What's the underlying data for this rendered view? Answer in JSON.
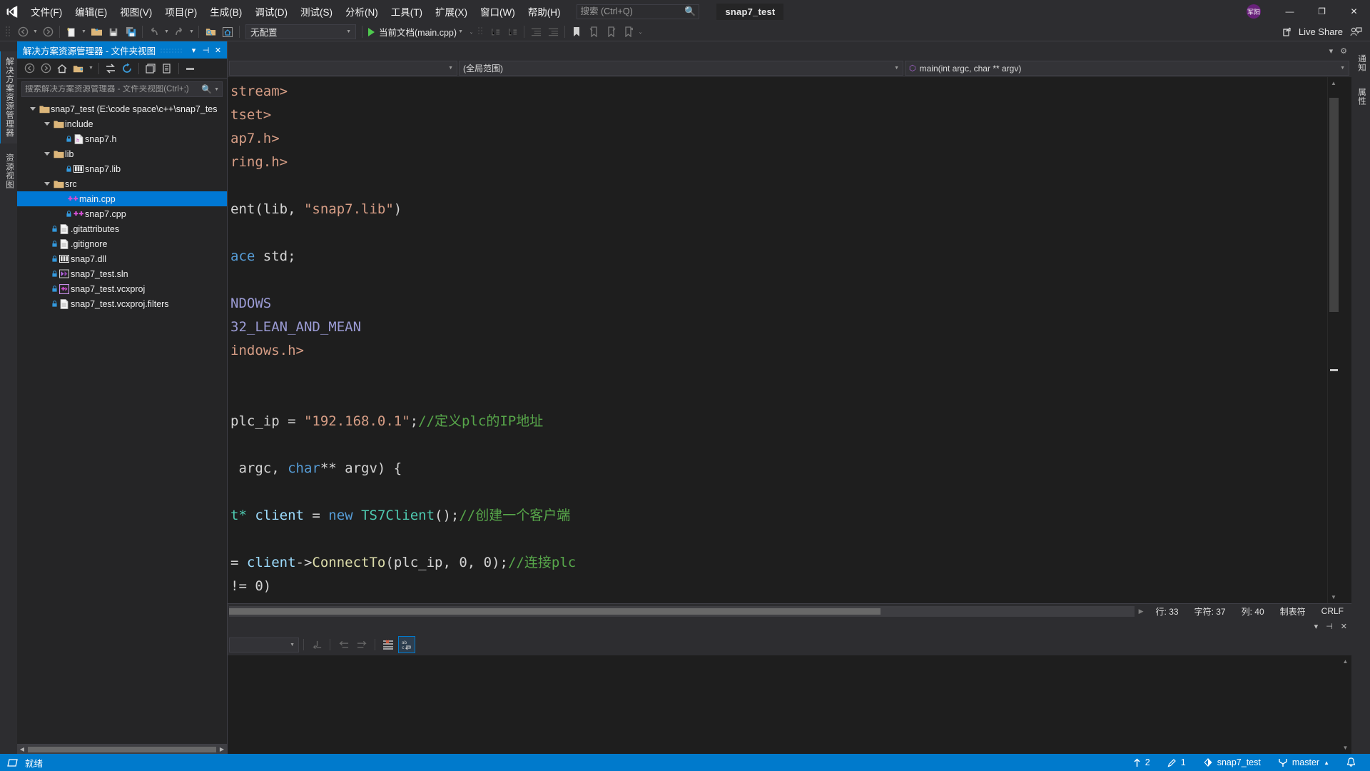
{
  "app": {
    "logo_icon": "visual-studio-logo",
    "solution_chip": "snap7_test"
  },
  "menu": {
    "items": [
      {
        "label": "文件(F)"
      },
      {
        "label": "编辑(E)"
      },
      {
        "label": "视图(V)"
      },
      {
        "label": "项目(P)"
      },
      {
        "label": "生成(B)"
      },
      {
        "label": "调试(D)"
      },
      {
        "label": "测试(S)"
      },
      {
        "label": "分析(N)"
      },
      {
        "label": "工具(T)"
      },
      {
        "label": "扩展(X)"
      },
      {
        "label": "窗口(W)"
      },
      {
        "label": "帮助(H)"
      }
    ],
    "search_placeholder": "搜索 (Ctrl+Q)",
    "search_value": "",
    "search_icon": "search-icon"
  },
  "window_controls": {
    "user_badge": "军阳",
    "minimize": "—",
    "maximize": "❐",
    "close": "✕"
  },
  "toolbar": {
    "config_value": "无配置",
    "run_target": "当前文档(main.cpp)",
    "live_share": "Live Share",
    "icons": [
      "back-arrow-icon",
      "forward-arrow-icon",
      "new-item-icon",
      "open-folder-icon",
      "save-icon",
      "save-all-icon",
      "undo-icon",
      "redo-icon",
      "find-icon",
      "home-icon",
      "bookmark-icon"
    ]
  },
  "left_tabs": [
    {
      "label": "解决方案资源管理器",
      "active": true
    },
    {
      "label": "资源视图",
      "active": false
    }
  ],
  "right_tabs": [
    {
      "label": "通知"
    },
    {
      "label": "属性"
    }
  ],
  "solution_explorer": {
    "title": "解决方案资源管理器 - 文件夹视图",
    "header_buttons": [
      "chevron-down-icon",
      "pin-icon",
      "close-icon"
    ],
    "toolbar_icons": [
      "nav-back-icon",
      "nav-forward-icon",
      "home-icon",
      "new-folder-icon",
      "sync-icon",
      "refresh-icon",
      "collapse-all-icon",
      "properties-icon",
      "show-all-icon"
    ],
    "search_placeholder": "搜索解决方案资源管理器 - 文件夹视图(Ctrl+;)",
    "search_value": "",
    "tree": [
      {
        "label": "snap7_test (E:\\code space\\c++\\snap7_tes",
        "depth": 0,
        "icon": "folder-icon",
        "expander": true,
        "selected": false,
        "lock": false
      },
      {
        "label": "include",
        "depth": 1,
        "icon": "folder-icon",
        "expander": true,
        "selected": false,
        "lock": false
      },
      {
        "label": "snap7.h",
        "depth": 2,
        "icon": "header-file-icon",
        "expander": false,
        "selected": false,
        "lock": true
      },
      {
        "label": "lib",
        "depth": 1,
        "icon": "folder-icon",
        "expander": true,
        "selected": false,
        "lock": false
      },
      {
        "label": "snap7.lib",
        "depth": 2,
        "icon": "library-file-icon",
        "expander": false,
        "selected": false,
        "lock": true
      },
      {
        "label": "src",
        "depth": 1,
        "icon": "folder-icon",
        "expander": true,
        "selected": false,
        "lock": false
      },
      {
        "label": "main.cpp",
        "depth": 2,
        "icon": "cpp-file-icon",
        "expander": false,
        "selected": true,
        "lock": false
      },
      {
        "label": "snap7.cpp",
        "depth": 2,
        "icon": "cpp-file-icon",
        "expander": false,
        "selected": false,
        "lock": true
      },
      {
        "label": ".gitattributes",
        "depth": 1,
        "icon": "text-file-icon",
        "expander": false,
        "selected": false,
        "lock": true
      },
      {
        "label": ".gitignore",
        "depth": 1,
        "icon": "text-file-icon",
        "expander": false,
        "selected": false,
        "lock": true
      },
      {
        "label": "snap7.dll",
        "depth": 1,
        "icon": "library-file-icon",
        "expander": false,
        "selected": false,
        "lock": true
      },
      {
        "label": "snap7_test.sln",
        "depth": 1,
        "icon": "solution-file-icon",
        "expander": false,
        "selected": false,
        "lock": true
      },
      {
        "label": "snap7_test.vcxproj",
        "depth": 1,
        "icon": "project-file-icon",
        "expander": false,
        "selected": false,
        "lock": true
      },
      {
        "label": "snap7_test.vcxproj.filters",
        "depth": 1,
        "icon": "text-file-icon",
        "expander": false,
        "selected": false,
        "lock": true
      }
    ]
  },
  "editor": {
    "nav_scope_value": "",
    "nav_scope_global": "(全局范围)",
    "nav_member": "main(int argc, char ** argv)",
    "nav_member_icon": "method-icon",
    "code_lines": [
      [
        {
          "t": "stream>",
          "c": "k-str"
        }
      ],
      [
        {
          "t": "tset>",
          "c": "k-str"
        }
      ],
      [
        {
          "t": "ap7.h>",
          "c": "k-str"
        }
      ],
      [
        {
          "t": "ring.h>",
          "c": "k-str"
        }
      ],
      [],
      [
        {
          "t": "ent(lib, ",
          "c": "k-txt"
        },
        {
          "t": "\"snap7.lib\"",
          "c": "k-str"
        },
        {
          "t": ")",
          "c": "k-txt"
        }
      ],
      [],
      [
        {
          "t": "ace",
          "c": "k-key"
        },
        {
          "t": " std;",
          "c": "k-txt"
        }
      ],
      [],
      [
        {
          "t": "NDOWS",
          "c": "k-pre"
        }
      ],
      [
        {
          "t": "32_LEAN_AND_MEAN",
          "c": "k-pre"
        }
      ],
      [
        {
          "t": "indows.h>",
          "c": "k-str"
        }
      ],
      [],
      [],
      [
        {
          "t": "plc_ip = ",
          "c": "k-txt"
        },
        {
          "t": "\"192.168.0.1\"",
          "c": "k-str"
        },
        {
          "t": ";",
          "c": "k-txt"
        },
        {
          "t": "//定义plc的IP地址",
          "c": "k-cmt"
        }
      ],
      [],
      [
        {
          "t": " argc, ",
          "c": "k-txt"
        },
        {
          "t": "char",
          "c": "k-key"
        },
        {
          "t": "** argv) {",
          "c": "k-txt"
        }
      ],
      [],
      [
        {
          "t": "t* ",
          "c": "k-type"
        },
        {
          "t": "client",
          "c": "k-var"
        },
        {
          "t": " = ",
          "c": "k-txt"
        },
        {
          "t": "new",
          "c": "k-key"
        },
        {
          "t": " ",
          "c": "k-txt"
        },
        {
          "t": "TS7Client",
          "c": "k-type"
        },
        {
          "t": "();",
          "c": "k-txt"
        },
        {
          "t": "//创建一个客户端",
          "c": "k-cmt"
        }
      ],
      [],
      [
        {
          "t": "= ",
          "c": "k-txt"
        },
        {
          "t": "client",
          "c": "k-var"
        },
        {
          "t": "->",
          "c": "k-txt"
        },
        {
          "t": "ConnectTo",
          "c": "k-fn"
        },
        {
          "t": "(plc_ip, 0, 0);",
          "c": "k-txt"
        },
        {
          "t": "//连接plc",
          "c": "k-cmt"
        }
      ],
      [
        {
          "t": "!= 0)",
          "c": "k-txt"
        }
      ]
    ],
    "status": {
      "line_label": "行: 33",
      "char_label": "字符: 37",
      "col_label": "列: 40",
      "tabs_label": "制表符",
      "eol_label": "CRLF"
    }
  },
  "output_panel": {
    "combo_value": "",
    "toolbar_icons": [
      "clear-icon",
      "go-to-previous-icon",
      "go-to-next-icon",
      "clear-all-icon",
      "word-wrap-icon"
    ],
    "header_icons": [
      "chevron-down-icon",
      "pin-icon",
      "close-icon"
    ],
    "content": ""
  },
  "statusbar": {
    "ready_label": "就绪",
    "ready_icon": "ready-icon",
    "outgoing_count": "2",
    "outgoing_icon": "arrow-up-icon",
    "edits_count": "1",
    "edits_icon": "pencil-icon",
    "repo_name": "snap7_test",
    "repo_icon": "source-control-icon",
    "branch_name": "master",
    "branch_icon": "branch-icon",
    "branch_caret": "▲",
    "bell_icon": "bell-icon"
  },
  "colors": {
    "accent": "#007acc",
    "selection": "#0078d4",
    "chrome": "#2d2d30",
    "panel": "#252526",
    "editor_bg": "#1e1e1e",
    "comment_green": "#57a64a",
    "string_orange": "#d69d85",
    "keyword_blue": "#569cd6",
    "preproc_purple": "#9b9bd4",
    "type_teal": "#4ec9b0",
    "func_yellow": "#dcdcaa"
  }
}
